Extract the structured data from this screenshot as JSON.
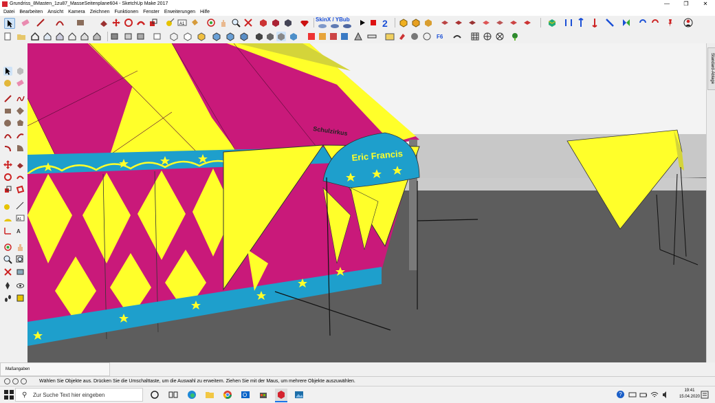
{
  "window": {
    "title": "Grundriss_8Masten_1zu87_MasseSeitenplane604 - SketchUp Make 2017",
    "minimize_glyph": "—",
    "restore_glyph": "❐",
    "close_glyph": "✕"
  },
  "menu": [
    "Datei",
    "Bearbeiten",
    "Ansicht",
    "Kamera",
    "Zeichnen",
    "Funktionen",
    "Fenster",
    "Erweiterungen",
    "Hilfe"
  ],
  "toolbar": {
    "skinx_label": "SkinX / YBub"
  },
  "scene": {
    "banner_text": "Eric Francis",
    "roof_text": "Schulzirkus",
    "colors": {
      "magenta": "#c9197a",
      "yellow": "#ffff2a",
      "blue": "#1e9fcc",
      "ground": "#5d5d5d",
      "sky": "#f2f2f2"
    }
  },
  "right_panel": {
    "tab_label": "Standard-Ablage"
  },
  "measure": {
    "label": "Maßangaben"
  },
  "status": {
    "message": "Wählen Sie Objekte aus. Drücken Sie die Umschalttaste, um die Auswahl zu erweitern. Ziehen Sie mit der Maus, um mehrere Objekte auszuwählen."
  },
  "taskbar": {
    "search_placeholder": "Zur Suche Text hier eingeben",
    "time": "19:41",
    "date": "15.04.2020",
    "help_glyph": "?"
  }
}
